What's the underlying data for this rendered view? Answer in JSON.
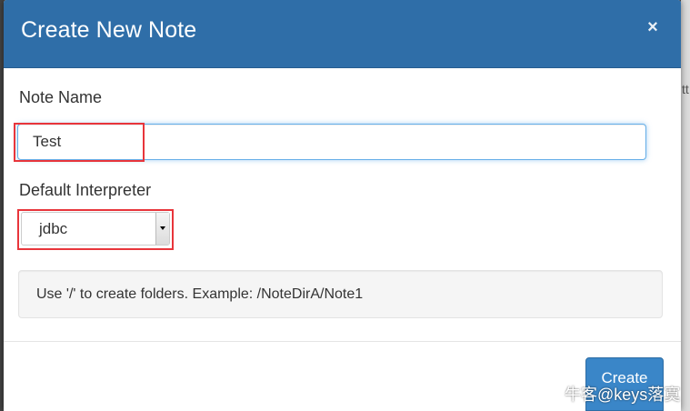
{
  "modal": {
    "title": "Create New Note",
    "close_symbol": "×"
  },
  "form": {
    "note_name_label": "Note Name",
    "note_name_value": "Test",
    "interpreter_label": "Default Interpreter",
    "interpreter_selected": "jdbc",
    "help_text": "Use '/' to create folders. Example: /NoteDirA/Note1"
  },
  "footer": {
    "create_label": "Create"
  },
  "watermark": {
    "text": "牛客@keys落寞"
  },
  "background": {
    "partial_text": "tt"
  },
  "colors": {
    "header": "#2f6ea8",
    "highlight": "#e8353b",
    "primary_button": "#3a86c8"
  },
  "icons": {
    "close": "close-icon",
    "select_caret": "caret-down-icon",
    "watermark_logo": "wechat-logo-icon"
  }
}
